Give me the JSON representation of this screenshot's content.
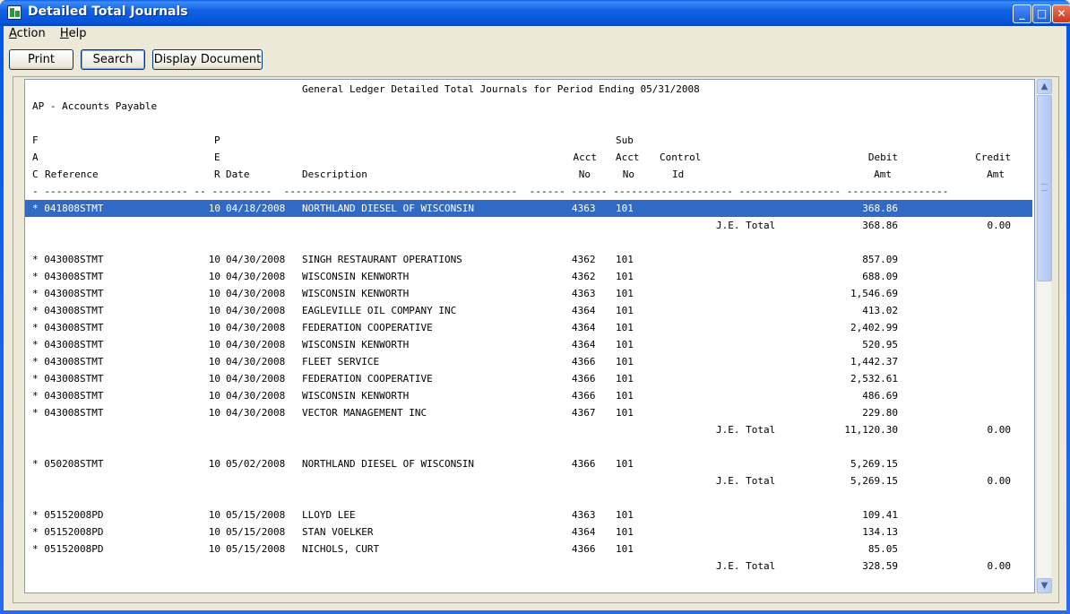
{
  "window": {
    "title": "Detailed Total Journals"
  },
  "titlebar_buttons": {
    "min": "_",
    "max": "□",
    "close": "✕"
  },
  "menu": {
    "action_ul": "A",
    "action_rest": "ction",
    "help_ul": "H",
    "help_rest": "elp"
  },
  "toolbar": {
    "print": "Print",
    "search": "Search",
    "display": "Display Document"
  },
  "report": {
    "header_title": "General Ledger Detailed Total Journals for Period Ending 05/31/2008",
    "journal_name": "AP - Accounts Payable",
    "col_head_1": {
      "f": "F",
      "p": "P",
      "sub": "Sub"
    },
    "col_head_2": {
      "a": "A",
      "e": "E",
      "acct": "Acct",
      "sub_acct": "Acct",
      "control": "Control",
      "debit": "Debit",
      "credit": "Credit"
    },
    "col_head_3": {
      "c": "C",
      "reference": "Reference",
      "r": "R",
      "date": "Date",
      "description": "Description",
      "acct_no": "No",
      "sub_no": "No",
      "control_id": "Id",
      "debit_amt": "Amt",
      "credit_amt": "Amt"
    },
    "dash_row": "- ------------------------ -- ----------  ---------------------------------------  ------ ------ -------------------- ----------------- -----------------",
    "rows": [
      {
        "kind": "detail",
        "selected": true,
        "ref": "* 041808STMT",
        "per": "10",
        "date": "04/18/2008",
        "desc": "NORTHLAND DIESEL OF WISCONSIN",
        "acct": "4363",
        "sub": "101",
        "debit": "368.86"
      },
      {
        "kind": "total",
        "label": "J.E. Total",
        "debit": "368.86",
        "credit": "0.00"
      },
      {
        "kind": "blank"
      },
      {
        "kind": "detail",
        "ref": "* 043008STMT",
        "per": "10",
        "date": "04/30/2008",
        "desc": "SINGH RESTAURANT OPERATIONS",
        "acct": "4362",
        "sub": "101",
        "debit": "857.09"
      },
      {
        "kind": "detail",
        "ref": "* 043008STMT",
        "per": "10",
        "date": "04/30/2008",
        "desc": "WISCONSIN KENWORTH",
        "acct": "4362",
        "sub": "101",
        "debit": "688.09"
      },
      {
        "kind": "detail",
        "ref": "* 043008STMT",
        "per": "10",
        "date": "04/30/2008",
        "desc": "WISCONSIN KENWORTH",
        "acct": "4363",
        "sub": "101",
        "debit": "1,546.69"
      },
      {
        "kind": "detail",
        "ref": "* 043008STMT",
        "per": "10",
        "date": "04/30/2008",
        "desc": "EAGLEVILLE OIL COMPANY INC",
        "acct": "4364",
        "sub": "101",
        "debit": "413.02"
      },
      {
        "kind": "detail",
        "ref": "* 043008STMT",
        "per": "10",
        "date": "04/30/2008",
        "desc": "FEDERATION COOPERATIVE",
        "acct": "4364",
        "sub": "101",
        "debit": "2,402.99"
      },
      {
        "kind": "detail",
        "ref": "* 043008STMT",
        "per": "10",
        "date": "04/30/2008",
        "desc": "WISCONSIN KENWORTH",
        "acct": "4364",
        "sub": "101",
        "debit": "520.95"
      },
      {
        "kind": "detail",
        "ref": "* 043008STMT",
        "per": "10",
        "date": "04/30/2008",
        "desc": "FLEET SERVICE",
        "acct": "4366",
        "sub": "101",
        "debit": "1,442.37"
      },
      {
        "kind": "detail",
        "ref": "* 043008STMT",
        "per": "10",
        "date": "04/30/2008",
        "desc": "FEDERATION COOPERATIVE",
        "acct": "4366",
        "sub": "101",
        "debit": "2,532.61"
      },
      {
        "kind": "detail",
        "ref": "* 043008STMT",
        "per": "10",
        "date": "04/30/2008",
        "desc": "WISCONSIN KENWORTH",
        "acct": "4366",
        "sub": "101",
        "debit": "486.69"
      },
      {
        "kind": "detail",
        "ref": "* 043008STMT",
        "per": "10",
        "date": "04/30/2008",
        "desc": "VECTOR MANAGEMENT INC",
        "acct": "4367",
        "sub": "101",
        "debit": "229.80"
      },
      {
        "kind": "total",
        "label": "J.E. Total",
        "debit": "11,120.30",
        "credit": "0.00"
      },
      {
        "kind": "blank"
      },
      {
        "kind": "detail",
        "ref": "* 050208STMT",
        "per": "10",
        "date": "05/02/2008",
        "desc": "NORTHLAND DIESEL OF WISCONSIN",
        "acct": "4366",
        "sub": "101",
        "debit": "5,269.15"
      },
      {
        "kind": "total",
        "label": "J.E. Total",
        "debit": "5,269.15",
        "credit": "0.00"
      },
      {
        "kind": "blank"
      },
      {
        "kind": "detail",
        "ref": "* 05152008PD",
        "per": "10",
        "date": "05/15/2008",
        "desc": "LLOYD LEE",
        "acct": "4363",
        "sub": "101",
        "debit": "109.41"
      },
      {
        "kind": "detail",
        "ref": "* 05152008PD",
        "per": "10",
        "date": "05/15/2008",
        "desc": "STAN VOELKER",
        "acct": "4364",
        "sub": "101",
        "debit": "134.13"
      },
      {
        "kind": "detail",
        "ref": "* 05152008PD",
        "per": "10",
        "date": "05/15/2008",
        "desc": "NICHOLS, CURT",
        "acct": "4366",
        "sub": "101",
        "debit": "85.05"
      },
      {
        "kind": "total",
        "label": "J.E. Total",
        "debit": "328.59",
        "credit": "0.00"
      }
    ]
  },
  "scrollbar": {
    "up": "▲",
    "down": "▼"
  }
}
